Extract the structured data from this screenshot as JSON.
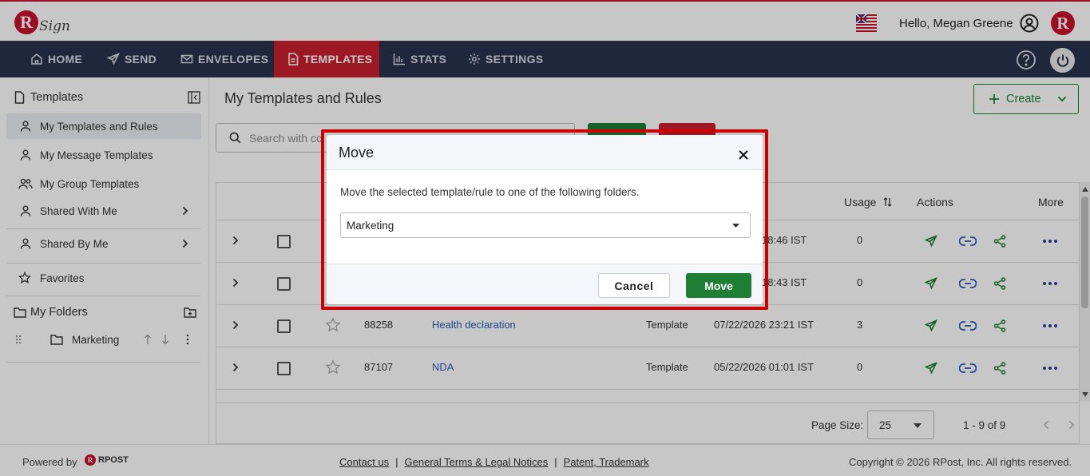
{
  "header": {
    "logo_letter": "R",
    "logo_text": "Sign",
    "greeting": "Hello, Megan Greene",
    "brand_letter": "R"
  },
  "nav": {
    "items": [
      {
        "label": "HOME",
        "icon": "home-icon"
      },
      {
        "label": "SEND",
        "icon": "send-icon"
      },
      {
        "label": "ENVELOPES",
        "icon": "envelope-icon"
      },
      {
        "label": "TEMPLATES",
        "icon": "document-icon",
        "active": true
      },
      {
        "label": "STATS",
        "icon": "bar-chart-icon"
      },
      {
        "label": "SETTINGS",
        "icon": "gear-icon"
      }
    ]
  },
  "sidebar": {
    "title": "Templates",
    "items": [
      {
        "label": "My Templates and Rules",
        "selected": true
      },
      {
        "label": "My Message Templates"
      },
      {
        "label": "My Group Templates"
      },
      {
        "label": "Shared With Me"
      },
      {
        "label": "Shared By Me"
      },
      {
        "label": "Favorites"
      }
    ],
    "folders_title": "My Folders",
    "folders": [
      {
        "label": "Marketing"
      }
    ]
  },
  "main": {
    "title": "My Templates and Rules",
    "create_label": "Create",
    "search_placeholder": "Search with co",
    "table": {
      "headers": {
        "usage": "Usage",
        "actions": "Actions",
        "more": "More"
      },
      "rows": [
        {
          "id": "",
          "name": "",
          "type": "",
          "date": "18:46 IST",
          "usage": "0"
        },
        {
          "id": "",
          "name": "",
          "type": "",
          "date": "18:43 IST",
          "usage": "0"
        },
        {
          "id": "88258",
          "name": "Health declaration",
          "type": "Template",
          "date": "07/22/2026 23:21 IST",
          "usage": "3"
        },
        {
          "id": "87107",
          "name": "NDA",
          "type": "Template",
          "date": "05/22/2026 01:01 IST",
          "usage": "0"
        }
      ]
    },
    "pager": {
      "page_size_label": "Page Size:",
      "page_size": "25",
      "range": "1 - 9 of 9"
    }
  },
  "modal": {
    "title": "Move",
    "description": "Move the selected template/rule to one of the following folders.",
    "selected_folder": "Marketing",
    "cancel_label": "Cancel",
    "move_label": "Move",
    "colors": {
      "highlight": "#cc0000",
      "primary": "#1e7e34"
    }
  },
  "footer": {
    "powered_by": "Powered by",
    "rpost": "RPOST",
    "links": [
      "Contact us",
      "General Terms & Legal Notices",
      "Patent, Trademark"
    ],
    "copyright": "Copyright © 2026 RPost, Inc. All rights reserved."
  }
}
